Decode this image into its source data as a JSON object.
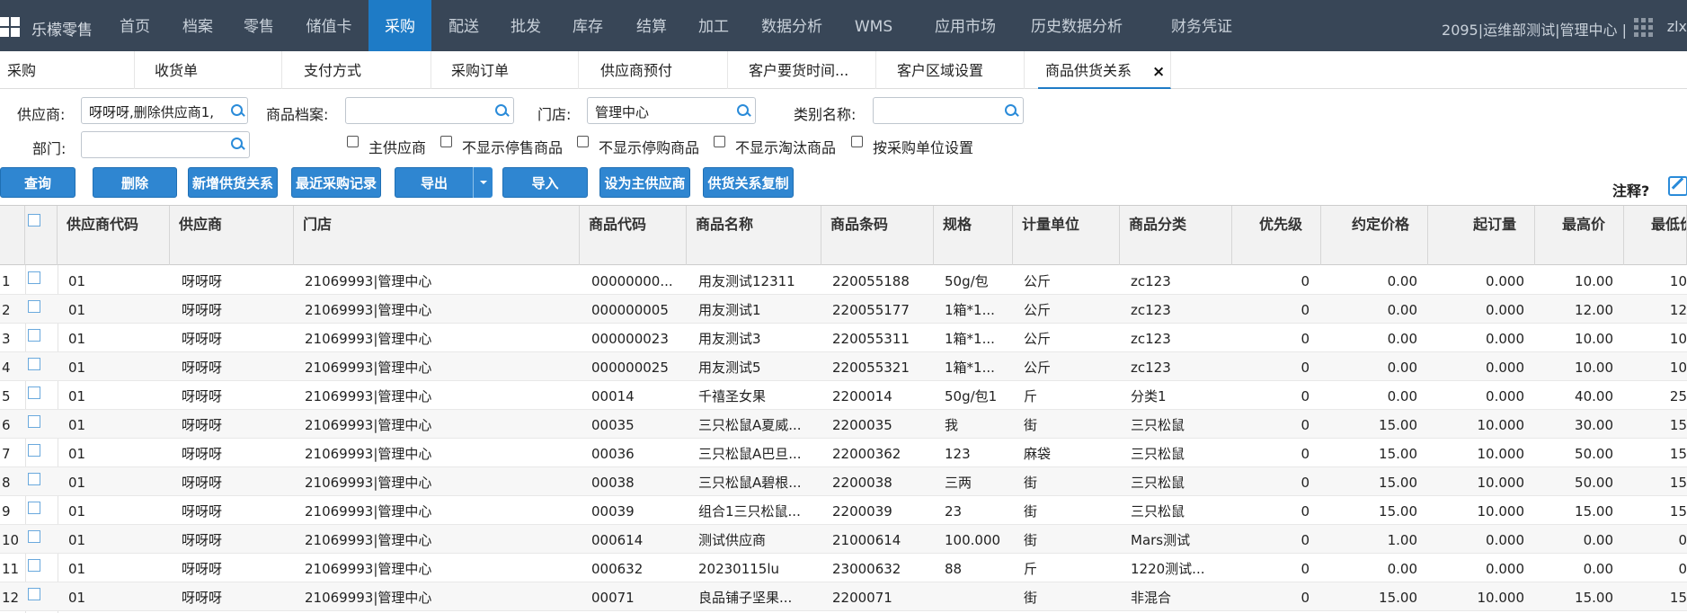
{
  "topnav": {
    "brand": "乐檬零售",
    "items": [
      "首页",
      "档案",
      "零售",
      "储值卡",
      "采购",
      "配送",
      "批发",
      "库存",
      "结算",
      "加工",
      "数据分析",
      "WMS",
      "应用市场",
      "历史数据分析",
      "财务凭证"
    ],
    "active": "采购",
    "user_info": "2095|运维部测试|管理中心 |",
    "user_name": "zlx"
  },
  "tabs": [
    "采购",
    "收货单",
    "支付方式",
    "采购订单",
    "供应商预付",
    "客户要货时间...",
    "客户区域设置",
    "商品供货关系"
  ],
  "active_tab": "商品供货关系",
  "tab_close": "×",
  "filters": {
    "supplier_label": "供应商:",
    "supplier_value": "呀呀呀,删除供应商1,",
    "product_label": "商品档案:",
    "product_value": "",
    "store_label": "门店:",
    "store_value": "管理中心",
    "category_label": "类别名称:",
    "category_value": "",
    "dept_label": "部门:",
    "dept_value": "",
    "checkboxes": [
      "主供应商",
      "不显示停售商品",
      "不显示停购商品",
      "不显示淘汰商品",
      "按采购单位设置"
    ]
  },
  "buttons": {
    "query": "查询",
    "delete": "删除",
    "add_relation": "新增供货关系",
    "recent_purchase": "最近采购记录",
    "export": "导出",
    "import": "导入",
    "set_main": "设为主供应商",
    "copy_relation": "供货关系复制"
  },
  "note_label": "注释?",
  "table": {
    "headers": [
      "供应商代码",
      "供应商",
      "门店",
      "商品代码",
      "商品名称",
      "商品条码",
      "规格",
      "计量单位",
      "商品分类",
      "优先级",
      "约定价格",
      "起订量",
      "最高价",
      "最低价"
    ],
    "rows": [
      [
        "1",
        "01",
        "呀呀呀",
        "21069993|管理中心",
        "00000000...",
        "用友测试12311",
        "220055188",
        "50g/包",
        "公斤",
        "zc123",
        "0",
        "0.00",
        "0.000",
        "10.00",
        "10"
      ],
      [
        "2",
        "01",
        "呀呀呀",
        "21069993|管理中心",
        "000000005",
        "用友测试1",
        "220055177",
        "1箱*1...",
        "公斤",
        "zc123",
        "0",
        "0.00",
        "0.000",
        "12.00",
        "12"
      ],
      [
        "3",
        "01",
        "呀呀呀",
        "21069993|管理中心",
        "000000023",
        "用友测试3",
        "220055311",
        "1箱*1...",
        "公斤",
        "zc123",
        "0",
        "0.00",
        "0.000",
        "10.00",
        "10"
      ],
      [
        "4",
        "01",
        "呀呀呀",
        "21069993|管理中心",
        "000000025",
        "用友测试5",
        "220055321",
        "1箱*1...",
        "公斤",
        "zc123",
        "0",
        "0.00",
        "0.000",
        "10.00",
        "10"
      ],
      [
        "5",
        "01",
        "呀呀呀",
        "21069993|管理中心",
        "00014",
        "千禧圣女果",
        "2200014",
        "50g/包1",
        "斤",
        "分类1",
        "0",
        "0.00",
        "0.000",
        "40.00",
        "25"
      ],
      [
        "6",
        "01",
        "呀呀呀",
        "21069993|管理中心",
        "00035",
        "三只松鼠A夏威...",
        "2200035",
        "我",
        "街",
        "三只松鼠",
        "0",
        "15.00",
        "10.000",
        "30.00",
        "15"
      ],
      [
        "7",
        "01",
        "呀呀呀",
        "21069993|管理中心",
        "00036",
        "三只松鼠A巴旦...",
        "22000362",
        "123",
        "麻袋",
        "三只松鼠",
        "0",
        "15.00",
        "10.000",
        "50.00",
        "15"
      ],
      [
        "8",
        "01",
        "呀呀呀",
        "21069993|管理中心",
        "00038",
        "三只松鼠A碧根...",
        "2200038",
        "三两",
        "街",
        "三只松鼠",
        "0",
        "15.00",
        "10.000",
        "50.00",
        "15"
      ],
      [
        "9",
        "01",
        "呀呀呀",
        "21069993|管理中心",
        "00039",
        "组合1三只松鼠...",
        "2200039",
        "23",
        "街",
        "三只松鼠",
        "0",
        "15.00",
        "10.000",
        "15.00",
        "15"
      ],
      [
        "10",
        "01",
        "呀呀呀",
        "21069993|管理中心",
        "000614",
        "测试供应商",
        "21000614",
        "100.000",
        "街",
        "Mars测试",
        "0",
        "1.00",
        "0.000",
        "0.00",
        "0"
      ],
      [
        "11",
        "01",
        "呀呀呀",
        "21069993|管理中心",
        "000632",
        "20230115lu",
        "23000632",
        "88",
        "斤",
        "1220测试...",
        "0",
        "0.00",
        "0.000",
        "0.00",
        "0"
      ],
      [
        "12",
        "01",
        "呀呀呀",
        "21069993|管理中心",
        "00071",
        "良品铺子坚果...",
        "2200071",
        "",
        "街",
        "非混合",
        "0",
        "15.00",
        "10.000",
        "15.00",
        "15"
      ]
    ]
  }
}
